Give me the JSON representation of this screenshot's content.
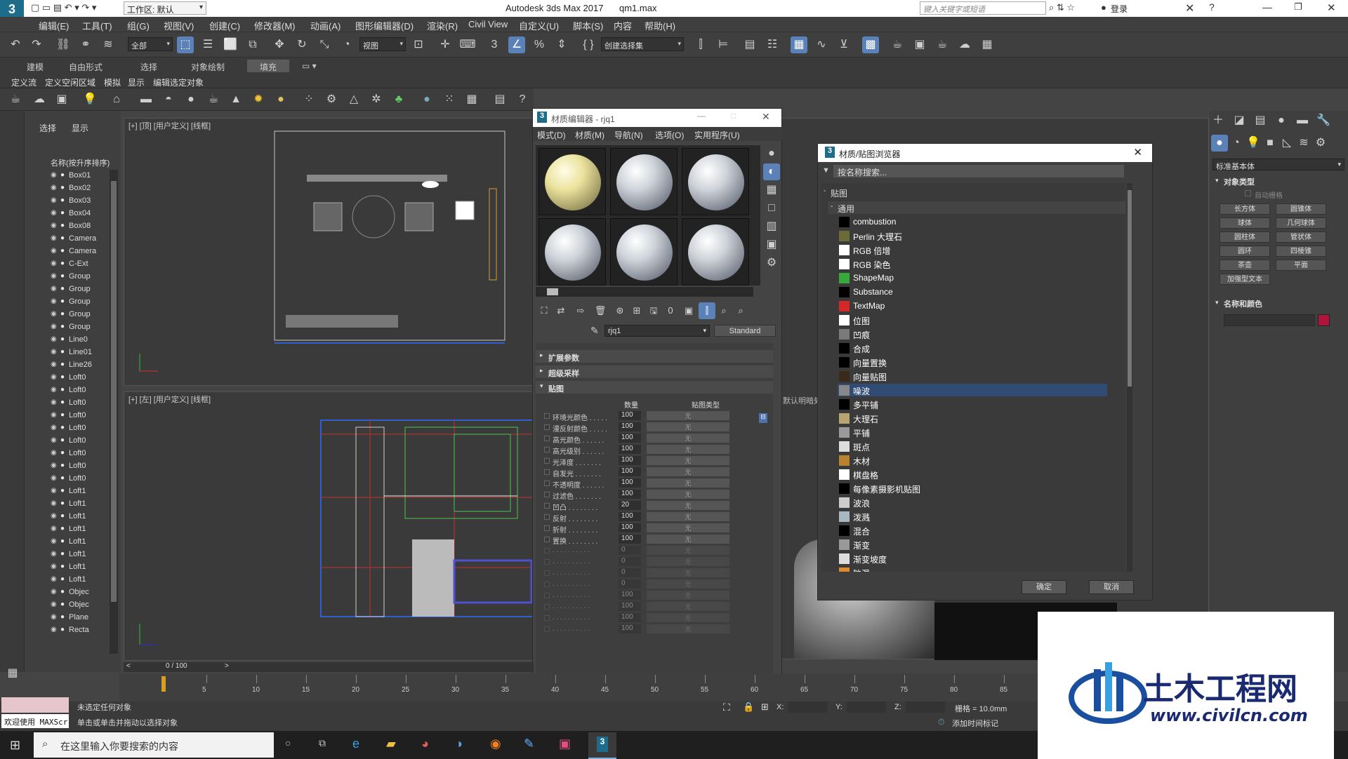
{
  "app": {
    "title": "Autodesk 3ds Max 2017",
    "file": "qm1.max",
    "workspace": "工作区: 默认",
    "search_placeholder": "键入关键字或短语",
    "login": "登录"
  },
  "menu": [
    "编辑(E)",
    "工具(T)",
    "组(G)",
    "视图(V)",
    "创建(C)",
    "修改器(M)",
    "动画(A)",
    "图形编辑器(D)",
    "渲染(R)",
    "Civil View",
    "自定义(U)",
    "脚本(S)",
    "内容",
    "帮助(H)"
  ],
  "toolbar": {
    "filter": "全部",
    "ref_coord": "视图",
    "named_set": "创建选择集"
  },
  "ribbon": {
    "tabs": [
      "建模",
      "自由形式",
      "选择",
      "对象绘制",
      "填充"
    ],
    "row2": [
      "定义流",
      "定义空闲区域",
      "模拟",
      "显示",
      "编辑选定对象"
    ]
  },
  "scene_explorer": {
    "tabs": [
      "选择",
      "显示"
    ],
    "header": "名称(按升序排序)",
    "items": [
      "Box01",
      "Box02",
      "Box03",
      "Box04",
      "Box08",
      "Camera",
      "Camera",
      "C-Ext",
      "Group",
      "Group",
      "Group",
      "Group",
      "Group",
      "Line0",
      "Line01",
      "Line26",
      "Loft0",
      "Loft0",
      "Loft0",
      "Loft0",
      "Loft0",
      "Loft0",
      "Loft0",
      "Loft0",
      "Loft0",
      "Loft1",
      "Loft1",
      "Loft1",
      "Loft1",
      "Loft1",
      "Loft1",
      "Loft1",
      "Loft1",
      "Objec",
      "Objec",
      "Plane",
      "Recta"
    ]
  },
  "viewports": {
    "top_label": "[+] [顶] [用户定义] [线框]",
    "left_label": "[+] [左] [用户定义] [线框]"
  },
  "material_editor": {
    "title": "材质编辑器 - rjq1",
    "menus": [
      "模式(D)",
      "材质(M)",
      "导航(N)",
      "选项(O)",
      "实用程序(U)"
    ],
    "material_name": "rjq1",
    "material_type": "Standard",
    "rollouts": [
      "扩展参数",
      "超级采样",
      "贴图"
    ],
    "col_amount": "数量",
    "col_maptype": "贴图类型",
    "maps": [
      {
        "label": "环境光颜色 . . . . .",
        "amount": "100",
        "map": "无"
      },
      {
        "label": "漫反射颜色 . . . . .",
        "amount": "100",
        "map": "无"
      },
      {
        "label": "高光颜色 . . . . . .",
        "amount": "100",
        "map": "无"
      },
      {
        "label": "高光级别 . . . . . .",
        "amount": "100",
        "map": "无"
      },
      {
        "label": "光泽度 . . . . . . .",
        "amount": "100",
        "map": "无"
      },
      {
        "label": "自发光 . . . . . . .",
        "amount": "100",
        "map": "无"
      },
      {
        "label": "不透明度 . . . . . .",
        "amount": "100",
        "map": "无"
      },
      {
        "label": "过滤色 . . . . . . .",
        "amount": "100",
        "map": "无"
      },
      {
        "label": "凹凸 . . . . . . . .",
        "amount": "20",
        "map": "无"
      },
      {
        "label": "反射 . . . . . . . .",
        "amount": "100",
        "map": "无"
      },
      {
        "label": "折射 . . . . . . . .",
        "amount": "100",
        "map": "无"
      },
      {
        "label": "置换 . . . . . . . .",
        "amount": "100",
        "map": "无"
      },
      {
        "label": ". . . . . . . . . .",
        "amount": "0",
        "map": "无"
      },
      {
        "label": ". . . . . . . . . .",
        "amount": "0",
        "map": "无"
      },
      {
        "label": ". . . . . . . . . .",
        "amount": "0",
        "map": "无"
      },
      {
        "label": ". . . . . . . . . .",
        "amount": "0",
        "map": "无"
      },
      {
        "label": ". . . . . . . . . .",
        "amount": "100",
        "map": "无"
      },
      {
        "label": ". . . . . . . . . .",
        "amount": "100",
        "map": "无"
      },
      {
        "label": ". . . . . . . . . .",
        "amount": "100",
        "map": "无"
      },
      {
        "label": ". . . . . . . . . .",
        "amount": "100",
        "map": "无"
      }
    ]
  },
  "map_browser": {
    "title": "材质/贴图浏览器",
    "search_placeholder": "按名称搜索...",
    "group": "贴图",
    "subgroup": "通用",
    "items": [
      {
        "name": "combustion",
        "color": "#000000"
      },
      {
        "name": "Perlin 大理石",
        "color": "#6b6b3a"
      },
      {
        "name": "RGB 倍增",
        "color": "#ffffff"
      },
      {
        "name": "RGB 染色",
        "color": "#ffffff"
      },
      {
        "name": "ShapeMap",
        "color": "#39a83a"
      },
      {
        "name": "Substance",
        "color": "#000000"
      },
      {
        "name": "TextMap",
        "color": "#d42828"
      },
      {
        "name": "位图",
        "color": "#ffffff"
      },
      {
        "name": "凹痕",
        "color": "#7a7a7a"
      },
      {
        "name": "合成",
        "color": "#000000"
      },
      {
        "name": "向量置换",
        "color": "#000000"
      },
      {
        "name": "向量贴图",
        "color": "#3a2a1a"
      },
      {
        "name": "噪波",
        "color": "#888888"
      },
      {
        "name": "多平铺",
        "color": "#000000"
      },
      {
        "name": "大理石",
        "color": "#b6a571"
      },
      {
        "name": "平铺",
        "color": "#9a9a9a"
      },
      {
        "name": "斑点",
        "color": "#dddddd"
      },
      {
        "name": "木材",
        "color": "#b8822e"
      },
      {
        "name": "棋盘格",
        "color": "#ffffff"
      },
      {
        "name": "每像素摄影机贴图",
        "color": "#000000"
      },
      {
        "name": "波浪",
        "color": "#cccccc"
      },
      {
        "name": "泼溅",
        "color": "#a8b8c2"
      },
      {
        "name": "混合",
        "color": "#000000"
      },
      {
        "name": "渐变",
        "color": "#999999"
      },
      {
        "name": "渐变坡度",
        "color": "#dddddd"
      },
      {
        "name": "粒混",
        "color": "#e08a2a"
      }
    ],
    "selected": "噪波",
    "ok": "确定",
    "cancel": "取消"
  },
  "command_panel": {
    "dropdown": "标准基本体",
    "section1": "对象类型",
    "autogrid": "自动栅格",
    "buttons": [
      "长方体",
      "圆锥体",
      "球体",
      "几何球体",
      "圆柱体",
      "管状体",
      "圆环",
      "四棱锥",
      "茶壶",
      "平面",
      "加强型文本"
    ],
    "section2": "名称和颜色",
    "accent": "#b0143c"
  },
  "timeline": {
    "frame": "0 / 100",
    "ticks": [
      "5",
      "10",
      "15",
      "20",
      "25",
      "30",
      "35",
      "40",
      "45",
      "50",
      "55",
      "60",
      "65",
      "70",
      "75",
      "80",
      "85"
    ]
  },
  "status": {
    "welcome": "欢迎使用 MAXScr",
    "line1": "未选定任何对象",
    "line2": "单击或单击并拖动以选择对象",
    "x_label": "X:",
    "y_label": "Y:",
    "z_label": "Z:",
    "grid": "栅格 = 10.0mm",
    "add_tag": "添加时间标记"
  },
  "taskbar": {
    "search": "在这里输入你要搜索的内容"
  },
  "viewport_text": "默认明暗处",
  "watermark": {
    "brand": "土木工程网",
    "url": "www.civilcn.com"
  }
}
